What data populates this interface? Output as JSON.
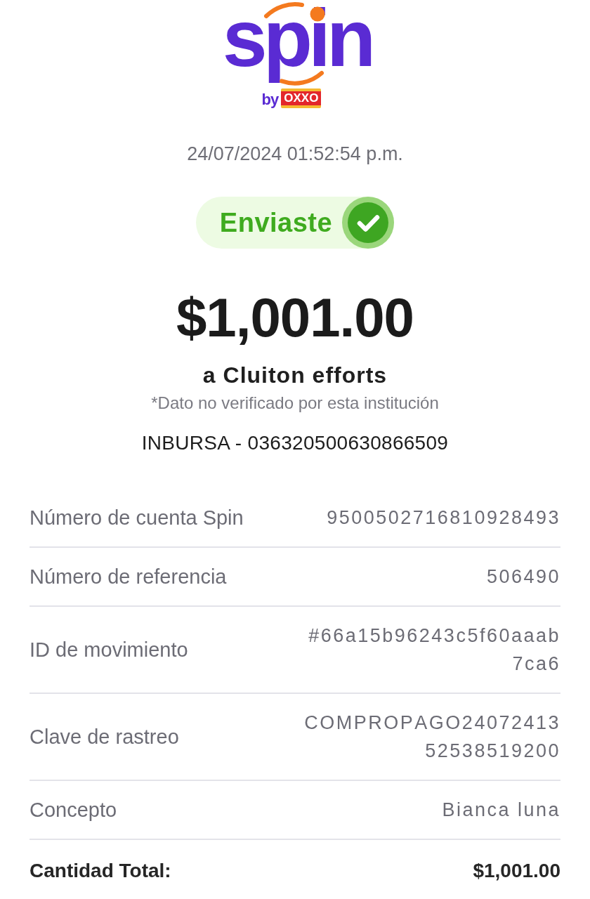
{
  "header": {
    "logo": {
      "wordmark": "spin",
      "byline": "by",
      "partner": "OXXO"
    },
    "timestamp": "24/07/2024 01:52:54 p.m."
  },
  "status": {
    "label": "Enviaste",
    "kind": "success"
  },
  "transfer": {
    "amount": "$1,001.00",
    "recipient": "a Cluiton efforts",
    "note": "*Dato no verificado por esta institución",
    "account": "INBURSA - 036320500630866509"
  },
  "details": [
    {
      "label": "Número de cuenta Spin",
      "value": "9500502716810928493"
    },
    {
      "label": "Número de referencia",
      "value": "506490"
    },
    {
      "label": "ID de movimiento",
      "value": "#66a15b96243c5f60aaab7ca6"
    },
    {
      "label": "Clave de rastreo",
      "value": "COMPROPAGO2407241352538519200"
    },
    {
      "label": "Concepto",
      "value": "Bianca luna"
    }
  ],
  "total": {
    "label": "Cantidad Total:",
    "value": "$1,001.00"
  }
}
